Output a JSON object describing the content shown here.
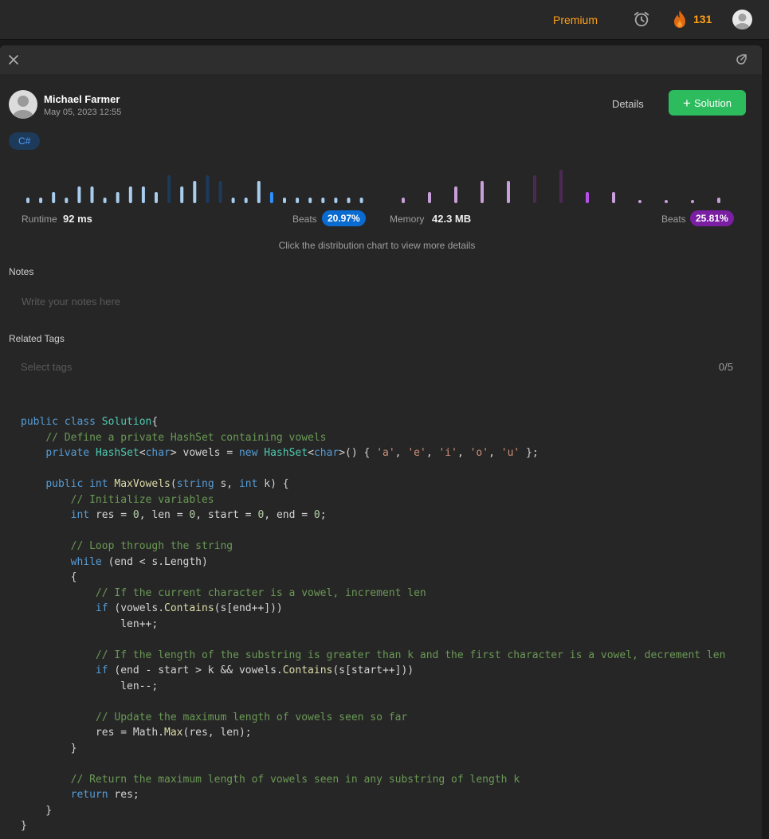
{
  "topbar": {
    "premium_label": "Premium",
    "streak_count": "131"
  },
  "submission": {
    "author": "Michael Farmer",
    "date": "May 05, 2023 12:55",
    "details_label": "Details",
    "solution_label": "Solution",
    "language": "C#"
  },
  "runtime": {
    "label": "Runtime",
    "value": "92 ms",
    "beats_label": "Beats",
    "beats": "20.97%",
    "badge_color": "#0a6bd1"
  },
  "memory": {
    "label": "Memory",
    "value": "42.3 MB",
    "beats_label": "Beats",
    "beats": "25.81%",
    "badge_color": "#7a1fa2"
  },
  "chart_data": [
    {
      "type": "bar",
      "name": "runtime-distribution",
      "values": [
        1,
        1,
        2,
        1,
        3,
        3,
        1,
        2,
        3,
        3,
        2,
        5,
        3,
        4,
        5,
        4,
        1,
        1,
        4,
        2,
        1,
        1,
        1,
        1,
        1,
        1,
        1
      ],
      "highlight_index": 19,
      "shaded_indices": [
        11,
        14,
        15
      ],
      "color": "#a9cdee",
      "shaded_color": "#1d3a5c",
      "highlight_color": "#2f90ff"
    },
    {
      "type": "bar",
      "name": "memory-distribution",
      "values": [
        1,
        2,
        3,
        4,
        4,
        5,
        6,
        2,
        2,
        0.5,
        0.5,
        0.5,
        1
      ],
      "highlight_index": 7,
      "shaded_indices": [
        5,
        6
      ],
      "color": "#c89fd8",
      "shaded_color": "#4a2a55",
      "highlight_color": "#b84fe8"
    }
  ],
  "hint_text": "Click the distribution chart to view more details",
  "notes": {
    "label": "Notes",
    "placeholder": "Write your notes here"
  },
  "tags": {
    "label": "Related Tags",
    "placeholder": "Select tags",
    "count": "0/5"
  },
  "code_lines": [
    [
      [
        "kw",
        "public class "
      ],
      [
        "ty",
        "Solution"
      ],
      [
        "",
        "{"
      ]
    ],
    [
      [
        "",
        "    "
      ],
      [
        "cm",
        "// Define a private HashSet containing vowels"
      ]
    ],
    [
      [
        "",
        "    "
      ],
      [
        "kw",
        "private "
      ],
      [
        "ty",
        "HashSet"
      ],
      [
        "",
        "<"
      ],
      [
        "kw",
        "char"
      ],
      [
        "",
        "> vowels = "
      ],
      [
        "kw",
        "new "
      ],
      [
        "ty",
        "HashSet"
      ],
      [
        "",
        "<"
      ],
      [
        "kw",
        "char"
      ],
      [
        "",
        ">() { "
      ],
      [
        "st",
        "'a'"
      ],
      [
        "",
        ", "
      ],
      [
        "st",
        "'e'"
      ],
      [
        "",
        ", "
      ],
      [
        "st",
        "'i'"
      ],
      [
        "",
        ", "
      ],
      [
        "st",
        "'o'"
      ],
      [
        "",
        ", "
      ],
      [
        "st",
        "'u'"
      ],
      [
        "",
        " };"
      ]
    ],
    [],
    [
      [
        "",
        "    "
      ],
      [
        "kw",
        "public int "
      ],
      [
        "fn",
        "MaxVowels"
      ],
      [
        "",
        "("
      ],
      [
        "kw",
        "string "
      ],
      [
        "",
        "s, "
      ],
      [
        "kw",
        "int "
      ],
      [
        "",
        "k) {"
      ]
    ],
    [
      [
        "",
        "        "
      ],
      [
        "cm",
        "// Initialize variables"
      ]
    ],
    [
      [
        "",
        "        "
      ],
      [
        "kw",
        "int "
      ],
      [
        "",
        "res = "
      ],
      [
        "nu",
        "0"
      ],
      [
        "",
        ", len = "
      ],
      [
        "nu",
        "0"
      ],
      [
        "",
        ", start = "
      ],
      [
        "nu",
        "0"
      ],
      [
        "",
        ", end = "
      ],
      [
        "nu",
        "0"
      ],
      [
        "",
        ";"
      ]
    ],
    [],
    [
      [
        "",
        "        "
      ],
      [
        "cm",
        "// Loop through the string"
      ]
    ],
    [
      [
        "",
        "        "
      ],
      [
        "kw",
        "while "
      ],
      [
        "",
        "(end < s.Length)"
      ]
    ],
    [
      [
        "",
        "        {"
      ]
    ],
    [
      [
        "",
        "            "
      ],
      [
        "cm",
        "// If the current character is a vowel, increment len"
      ]
    ],
    [
      [
        "",
        "            "
      ],
      [
        "kw",
        "if "
      ],
      [
        "",
        "(vowels."
      ],
      [
        "fn",
        "Contains"
      ],
      [
        "",
        "(s[end++]))"
      ]
    ],
    [
      [
        "",
        "                len++;"
      ]
    ],
    [],
    [
      [
        "",
        "            "
      ],
      [
        "cm",
        "// If the length of the substring is greater than k and the first character is a vowel, decrement len"
      ]
    ],
    [
      [
        "",
        "            "
      ],
      [
        "kw",
        "if "
      ],
      [
        "",
        "(end - start > k && vowels."
      ],
      [
        "fn",
        "Contains"
      ],
      [
        "",
        "(s[start++]))"
      ]
    ],
    [
      [
        "",
        "                len--;"
      ]
    ],
    [],
    [
      [
        "",
        "            "
      ],
      [
        "cm",
        "// Update the maximum length of vowels seen so far"
      ]
    ],
    [
      [
        "",
        "            res = Math."
      ],
      [
        "fn",
        "Max"
      ],
      [
        "",
        "(res, len);"
      ]
    ],
    [
      [
        "",
        "        }"
      ]
    ],
    [],
    [
      [
        "",
        "        "
      ],
      [
        "cm",
        "// Return the maximum length of vowels seen in any substring of length k"
      ]
    ],
    [
      [
        "",
        "        "
      ],
      [
        "kw",
        "return "
      ],
      [
        "",
        "res;"
      ]
    ],
    [
      [
        "",
        "    }"
      ]
    ],
    [
      [
        "",
        "}"
      ]
    ]
  ]
}
